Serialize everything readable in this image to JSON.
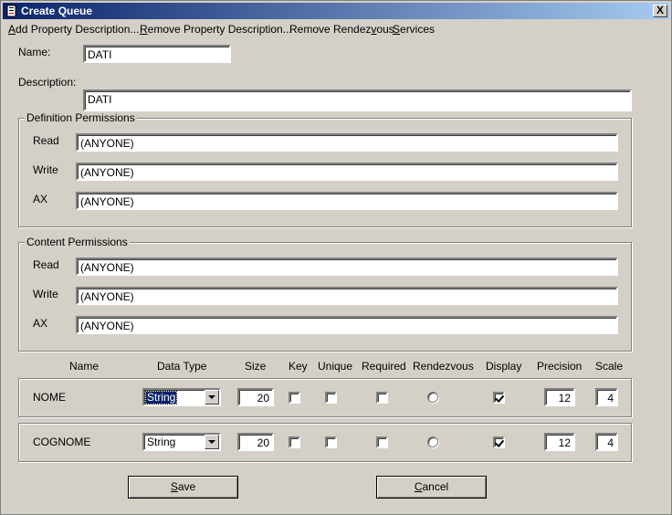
{
  "window": {
    "title": "Create Queue",
    "close_label": "X"
  },
  "menu": {
    "add_property": {
      "accel": "A",
      "rest": "dd Property Description..."
    },
    "remove_property": {
      "accel": "R",
      "rest": "emove Property Description..."
    },
    "remove_rendezvous": {
      "pre": "Remove Rendez",
      "accel": "v",
      "rest": "ous"
    },
    "services": {
      "accel": "S",
      "rest": "ervices"
    }
  },
  "form": {
    "name_label": "Name:",
    "name_value": "DATI",
    "description_label": "Description:",
    "description_value": "DATI"
  },
  "definition_permissions": {
    "title": "Definition Permissions",
    "read_label": "Read",
    "read_value": "(ANYONE)",
    "write_label": "Write",
    "write_value": "(ANYONE)",
    "ax_label": "AX",
    "ax_value": "(ANYONE)"
  },
  "content_permissions": {
    "title": "Content Permissions",
    "read_label": "Read",
    "read_value": "(ANYONE)",
    "write_label": "Write",
    "write_value": "(ANYONE)",
    "ax_label": "AX",
    "ax_value": "(ANYONE)"
  },
  "columns": {
    "name": "Name",
    "data_type": "Data Type",
    "size": "Size",
    "key": "Key",
    "unique": "Unique",
    "required": "Required",
    "rendezvous": "Rendezvous",
    "display": "Display",
    "precision": "Precision",
    "scale": "Scale"
  },
  "properties": [
    {
      "name": "NOME",
      "data_type": "String",
      "size": "20",
      "key": false,
      "unique": false,
      "required": false,
      "rendezvous": false,
      "display": true,
      "precision": "12",
      "scale": "4"
    },
    {
      "name": "COGNOME",
      "data_type": "String",
      "size": "20",
      "key": false,
      "unique": false,
      "required": false,
      "rendezvous": false,
      "display": true,
      "precision": "12",
      "scale": "4"
    }
  ],
  "buttons": {
    "save": {
      "accel": "S",
      "rest": "ave"
    },
    "cancel": {
      "accel": "C",
      "rest": "ancel"
    }
  }
}
